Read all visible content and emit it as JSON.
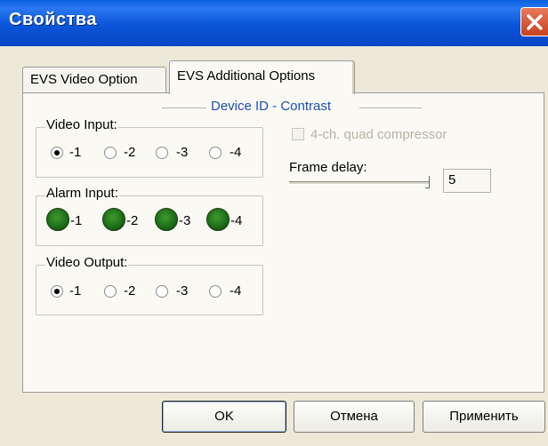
{
  "window": {
    "title": "Свойства"
  },
  "tabs": [
    {
      "label": "EVS Video Option",
      "active": false
    },
    {
      "label": "EVS Additional Options",
      "active": true
    }
  ],
  "panel": {
    "section_title": "Device ID - Contrast",
    "video_input": {
      "label": "Video Input:",
      "options": [
        "-1",
        "-2",
        "-3",
        "-4"
      ],
      "selected": "-1"
    },
    "alarm_input": {
      "label": "Alarm Input:",
      "options": [
        "-1",
        "-2",
        "-3",
        "-4"
      ],
      "led_color": "#1f6f18"
    },
    "video_output": {
      "label": "Video Output:",
      "options": [
        "-1",
        "-2",
        "-3",
        "-4"
      ],
      "selected": "-1"
    },
    "quad_compressor": {
      "label": "4-ch. quad compressor",
      "checked": false,
      "enabled": false
    },
    "frame_delay": {
      "label": "Frame delay:",
      "value": "5"
    }
  },
  "buttons": {
    "ok": "OK",
    "cancel": "Отмена",
    "apply": "Применить"
  },
  "colors": {
    "titlebar": "#0b55d8",
    "section_title": "#1a4fb8",
    "close": "#d65a37"
  }
}
